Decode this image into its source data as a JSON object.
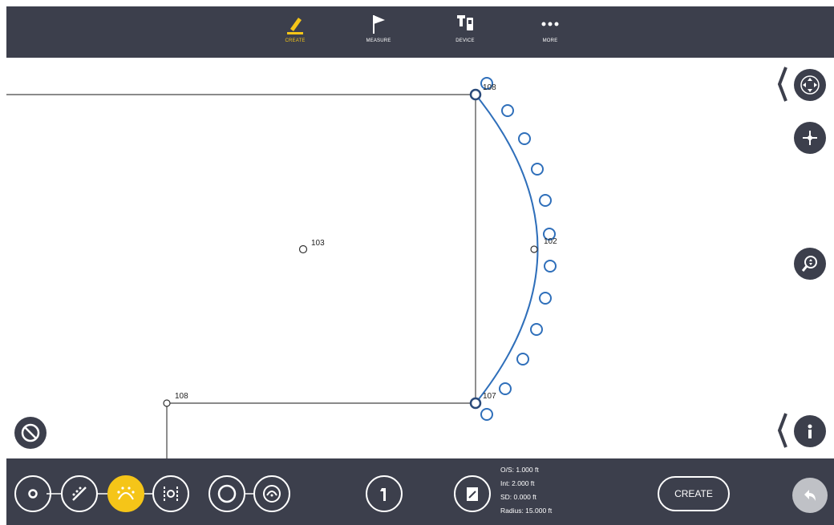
{
  "toolbar": {
    "tabs": [
      {
        "label": "CREATE",
        "icon": "pencil-icon",
        "active": true
      },
      {
        "label": "MEASURE",
        "icon": "flag-icon",
        "active": false
      },
      {
        "label": "DEVICE",
        "icon": "device-icon",
        "active": false
      },
      {
        "label": "MORE",
        "icon": "more-dots-icon",
        "active": false
      }
    ]
  },
  "canvas": {
    "points": [
      {
        "label": "103"
      },
      {
        "label": "102"
      },
      {
        "label": "108"
      },
      {
        "label": "107"
      },
      {
        "label": "108"
      }
    ]
  },
  "stats": {
    "os": "O/S:  1.000 ft",
    "int": "Int:  2.000 ft",
    "sd": "SD:  0.000 ft",
    "radius": "Radius:  15.000 ft"
  },
  "actions": {
    "create_label": "CREATE"
  },
  "colors": {
    "bar": "#3c3f4c",
    "accent": "#f5c518",
    "arc": "#2f6fba"
  }
}
